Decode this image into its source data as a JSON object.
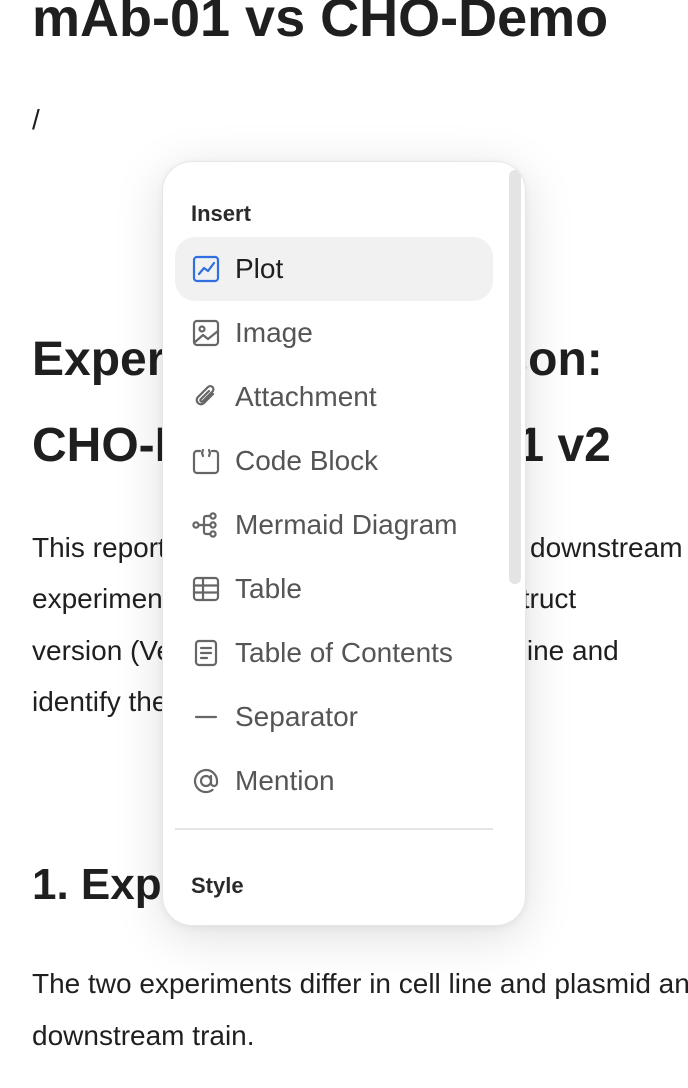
{
  "document": {
    "title": "mAb-01 vs CHO-Demo",
    "slash_text": "/",
    "heading_line1": "Experiment Comparison:",
    "heading_line2": "CHO-Demo vs mAb-01 v2",
    "intro_lines": [
      "This report compares the upstream and downstream",
      "experiments that differ in cell line / construct",
      "version (Vector A vs Vector B) to determine and",
      "identify the key process differences."
    ],
    "section1_heading": "1. Experimental Design",
    "section1_lines": [
      "The two experiments differ in cell line and plasmid and",
      "downstream train."
    ]
  },
  "slash_menu": {
    "insert_label": "Insert",
    "style_label": "Style",
    "accent_color": "#2f6fe0",
    "icon_color": "#666666",
    "items": [
      {
        "label": "Plot",
        "icon": "chart-icon",
        "active": true
      },
      {
        "label": "Image",
        "icon": "image-icon",
        "active": false
      },
      {
        "label": "Attachment",
        "icon": "paperclip-icon",
        "active": false
      },
      {
        "label": "Code Block",
        "icon": "code-block-icon",
        "active": false
      },
      {
        "label": "Mermaid Diagram",
        "icon": "diagram-icon",
        "active": false
      },
      {
        "label": "Table",
        "icon": "table-icon",
        "active": false
      },
      {
        "label": "Table of Contents",
        "icon": "toc-icon",
        "active": false
      },
      {
        "label": "Separator",
        "icon": "separator-icon",
        "active": false
      },
      {
        "label": "Mention",
        "icon": "at-icon",
        "active": false
      }
    ]
  }
}
